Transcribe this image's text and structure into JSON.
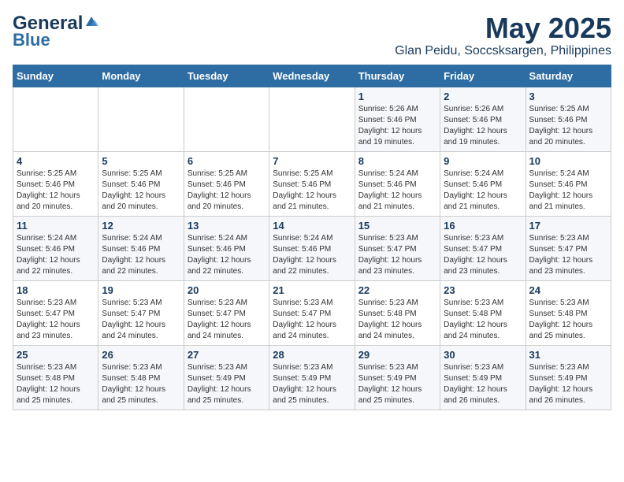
{
  "logo": {
    "line1": "General",
    "line2": "Blue"
  },
  "title": "May 2025",
  "subtitle": "Glan Peidu, Soccsksargen, Philippines",
  "days_of_week": [
    "Sunday",
    "Monday",
    "Tuesday",
    "Wednesday",
    "Thursday",
    "Friday",
    "Saturday"
  ],
  "weeks": [
    [
      {
        "day": "",
        "info": ""
      },
      {
        "day": "",
        "info": ""
      },
      {
        "day": "",
        "info": ""
      },
      {
        "day": "",
        "info": ""
      },
      {
        "day": "1",
        "info": "Sunrise: 5:26 AM\nSunset: 5:46 PM\nDaylight: 12 hours\nand 19 minutes."
      },
      {
        "day": "2",
        "info": "Sunrise: 5:26 AM\nSunset: 5:46 PM\nDaylight: 12 hours\nand 19 minutes."
      },
      {
        "day": "3",
        "info": "Sunrise: 5:25 AM\nSunset: 5:46 PM\nDaylight: 12 hours\nand 20 minutes."
      }
    ],
    [
      {
        "day": "4",
        "info": "Sunrise: 5:25 AM\nSunset: 5:46 PM\nDaylight: 12 hours\nand 20 minutes."
      },
      {
        "day": "5",
        "info": "Sunrise: 5:25 AM\nSunset: 5:46 PM\nDaylight: 12 hours\nand 20 minutes."
      },
      {
        "day": "6",
        "info": "Sunrise: 5:25 AM\nSunset: 5:46 PM\nDaylight: 12 hours\nand 20 minutes."
      },
      {
        "day": "7",
        "info": "Sunrise: 5:25 AM\nSunset: 5:46 PM\nDaylight: 12 hours\nand 21 minutes."
      },
      {
        "day": "8",
        "info": "Sunrise: 5:24 AM\nSunset: 5:46 PM\nDaylight: 12 hours\nand 21 minutes."
      },
      {
        "day": "9",
        "info": "Sunrise: 5:24 AM\nSunset: 5:46 PM\nDaylight: 12 hours\nand 21 minutes."
      },
      {
        "day": "10",
        "info": "Sunrise: 5:24 AM\nSunset: 5:46 PM\nDaylight: 12 hours\nand 21 minutes."
      }
    ],
    [
      {
        "day": "11",
        "info": "Sunrise: 5:24 AM\nSunset: 5:46 PM\nDaylight: 12 hours\nand 22 minutes."
      },
      {
        "day": "12",
        "info": "Sunrise: 5:24 AM\nSunset: 5:46 PM\nDaylight: 12 hours\nand 22 minutes."
      },
      {
        "day": "13",
        "info": "Sunrise: 5:24 AM\nSunset: 5:46 PM\nDaylight: 12 hours\nand 22 minutes."
      },
      {
        "day": "14",
        "info": "Sunrise: 5:24 AM\nSunset: 5:46 PM\nDaylight: 12 hours\nand 22 minutes."
      },
      {
        "day": "15",
        "info": "Sunrise: 5:23 AM\nSunset: 5:47 PM\nDaylight: 12 hours\nand 23 minutes."
      },
      {
        "day": "16",
        "info": "Sunrise: 5:23 AM\nSunset: 5:47 PM\nDaylight: 12 hours\nand 23 minutes."
      },
      {
        "day": "17",
        "info": "Sunrise: 5:23 AM\nSunset: 5:47 PM\nDaylight: 12 hours\nand 23 minutes."
      }
    ],
    [
      {
        "day": "18",
        "info": "Sunrise: 5:23 AM\nSunset: 5:47 PM\nDaylight: 12 hours\nand 23 minutes."
      },
      {
        "day": "19",
        "info": "Sunrise: 5:23 AM\nSunset: 5:47 PM\nDaylight: 12 hours\nand 24 minutes."
      },
      {
        "day": "20",
        "info": "Sunrise: 5:23 AM\nSunset: 5:47 PM\nDaylight: 12 hours\nand 24 minutes."
      },
      {
        "day": "21",
        "info": "Sunrise: 5:23 AM\nSunset: 5:47 PM\nDaylight: 12 hours\nand 24 minutes."
      },
      {
        "day": "22",
        "info": "Sunrise: 5:23 AM\nSunset: 5:48 PM\nDaylight: 12 hours\nand 24 minutes."
      },
      {
        "day": "23",
        "info": "Sunrise: 5:23 AM\nSunset: 5:48 PM\nDaylight: 12 hours\nand 24 minutes."
      },
      {
        "day": "24",
        "info": "Sunrise: 5:23 AM\nSunset: 5:48 PM\nDaylight: 12 hours\nand 25 minutes."
      }
    ],
    [
      {
        "day": "25",
        "info": "Sunrise: 5:23 AM\nSunset: 5:48 PM\nDaylight: 12 hours\nand 25 minutes."
      },
      {
        "day": "26",
        "info": "Sunrise: 5:23 AM\nSunset: 5:48 PM\nDaylight: 12 hours\nand 25 minutes."
      },
      {
        "day": "27",
        "info": "Sunrise: 5:23 AM\nSunset: 5:49 PM\nDaylight: 12 hours\nand 25 minutes."
      },
      {
        "day": "28",
        "info": "Sunrise: 5:23 AM\nSunset: 5:49 PM\nDaylight: 12 hours\nand 25 minutes."
      },
      {
        "day": "29",
        "info": "Sunrise: 5:23 AM\nSunset: 5:49 PM\nDaylight: 12 hours\nand 25 minutes."
      },
      {
        "day": "30",
        "info": "Sunrise: 5:23 AM\nSunset: 5:49 PM\nDaylight: 12 hours\nand 26 minutes."
      },
      {
        "day": "31",
        "info": "Sunrise: 5:23 AM\nSunset: 5:49 PM\nDaylight: 12 hours\nand 26 minutes."
      }
    ]
  ]
}
